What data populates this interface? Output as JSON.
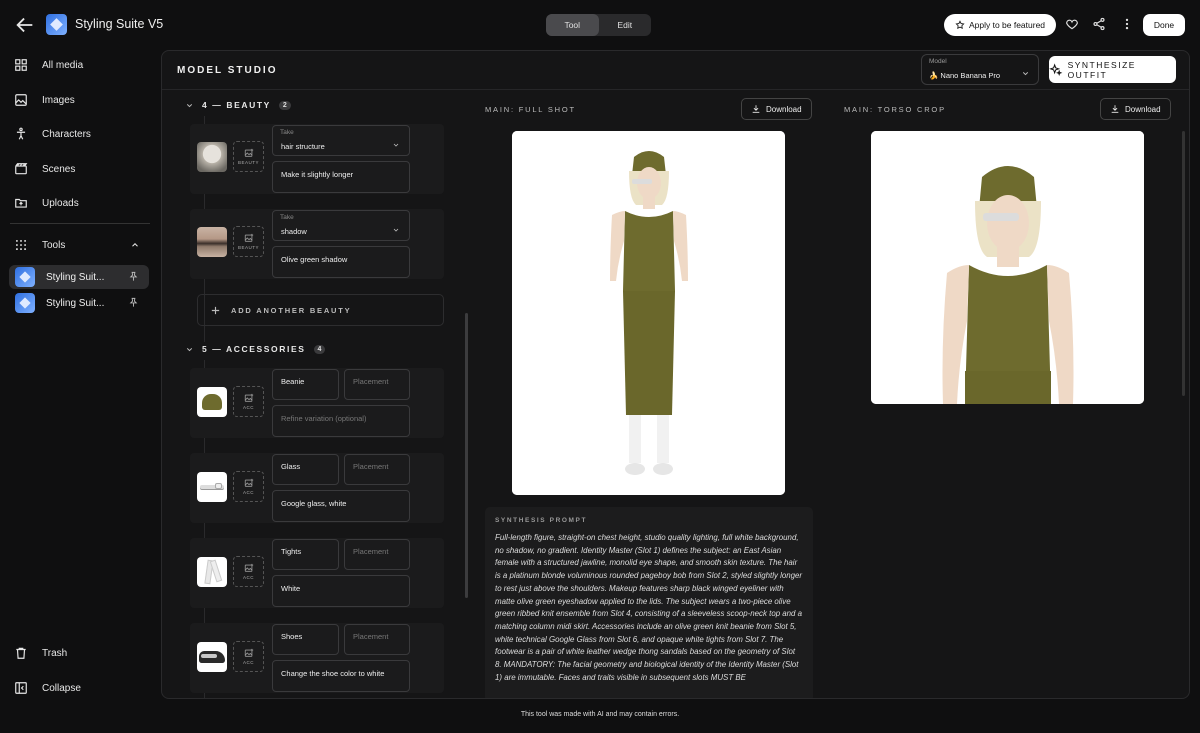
{
  "header": {
    "app_title": "Styling Suite V5",
    "mode_tabs": [
      "Tool",
      "Edit"
    ],
    "active_tab": "Tool",
    "apply_featured_label": "Apply to be featured",
    "done_label": "Done"
  },
  "sidebar": {
    "items": [
      {
        "label": "All media",
        "icon": "grid-icon"
      },
      {
        "label": "Images",
        "icon": "image-icon"
      },
      {
        "label": "Characters",
        "icon": "person-icon"
      },
      {
        "label": "Scenes",
        "icon": "clapper-icon"
      },
      {
        "label": "Uploads",
        "icon": "folder-upload-icon"
      }
    ],
    "tools_label": "Tools",
    "pinned": [
      {
        "label": "Styling Suit...",
        "active": true
      },
      {
        "label": "Styling Suit...",
        "active": false
      }
    ],
    "trash_label": "Trash",
    "collapse_label": "Collapse"
  },
  "studio": {
    "title": "MODEL STUDIO",
    "model_label": "Model",
    "model_value": "🍌 Nano Banana Pro",
    "synthesize_label": "SYNTHESIZE OUTFIT"
  },
  "beauty": {
    "heading": "4 — BEAUTY",
    "count": "2",
    "upload_tag": "BEAUTY",
    "take_label": "Take",
    "items": [
      {
        "take": "hair structure",
        "note": "Make it slightly longer"
      },
      {
        "take": "shadow",
        "note": "Olive green shadow"
      }
    ],
    "add_label": "ADD ANOTHER BEAUTY"
  },
  "accessories": {
    "heading": "5 — ACCESSORIES",
    "count": "4",
    "upload_tag": "ACC",
    "placement_placeholder": "Placement",
    "items": [
      {
        "name": "Beanie",
        "refine": "",
        "refine_placeholder": "Refine variation (optional)"
      },
      {
        "name": "Glass",
        "refine": "Google glass, white"
      },
      {
        "name": "Tights",
        "refine": "White"
      },
      {
        "name": "Shoes",
        "refine": "Change the shoe color to white"
      }
    ]
  },
  "previews": {
    "full_label": "MAIN: FULL SHOT",
    "torso_label": "MAIN: TORSO CROP",
    "download_label": "Download"
  },
  "prompt": {
    "label": "SYNTHESIS PROMPT",
    "text": "Full-length figure, straight-on chest height, studio quality lighting, full white background, no shadow, no gradient. Identity Master (Slot 1) defines the subject: an East Asian female with a structured jawline, monolid eye shape, and smooth skin texture. The hair is a platinum blonde voluminous rounded pageboy bob from Slot 2, styled slightly longer to rest just above the shoulders. Makeup features sharp black winged eyeliner with matte olive green eyeshadow applied to the lids. The subject wears a two-piece olive green ribbed knit ensemble from Slot 4, consisting of a sleeveless scoop-neck top and a matching column midi skirt. Accessories include an olive green knit beanie from Slot 5, white technical Google Glass from Slot 6, and opaque white tights from Slot 7. The footwear is a pair of white leather wedge thong sandals based on the geometry of Slot 8. MANDATORY: The facial geometry and biological identity of the Identity Master (Slot 1) are immutable. Faces and traits visible in subsequent slots MUST BE"
  },
  "footer": "This tool was made with AI and may contain errors.",
  "colors": {
    "accent_white": "#ffffff",
    "olive": "#6e6b2e",
    "panel": "#151516"
  }
}
